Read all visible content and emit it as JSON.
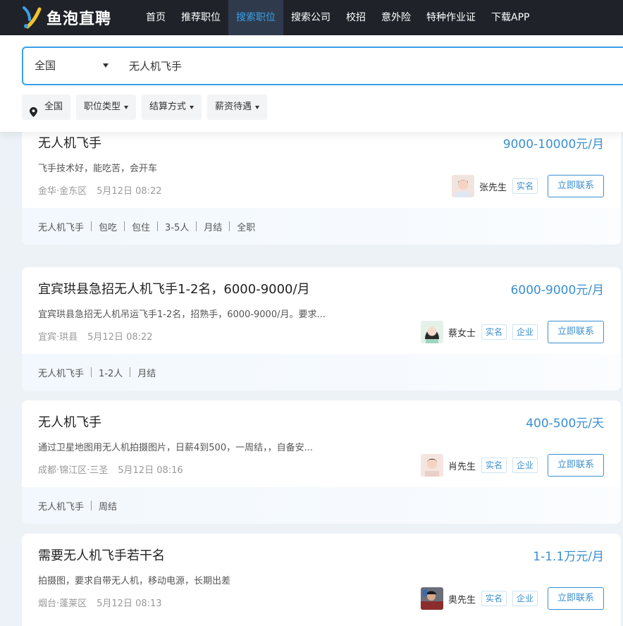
{
  "brand": {
    "name": "鱼泡直聘"
  },
  "nav": {
    "items": [
      {
        "label": "首页",
        "active": false
      },
      {
        "label": "推荐职位",
        "active": false
      },
      {
        "label": "搜索职位",
        "active": true
      },
      {
        "label": "搜索公司",
        "active": false
      },
      {
        "label": "校招",
        "active": false
      },
      {
        "label": "意外险",
        "active": false
      },
      {
        "label": "特种作业证",
        "active": false
      },
      {
        "label": "下载APP",
        "active": false
      }
    ]
  },
  "search": {
    "region": "全国",
    "query": "无人机飞手"
  },
  "filters": {
    "location": "全国",
    "job_type": "职位类型",
    "settlement": "结算方式",
    "salary": "薪资待遇"
  },
  "colors": {
    "accent": "#3a8fd0",
    "nav_bg": "#1f2329"
  },
  "jobs": [
    {
      "title": "无人机飞手",
      "salary": "9000-10000元/月",
      "desc": "飞手技术好，能吃苦，会开车",
      "location": "金华·金东区",
      "time": "5月12日 08:22",
      "contact": "张先生",
      "badges": [
        "实名"
      ],
      "avatar": "male-avatar-1",
      "tags": [
        "无人机飞手",
        "包吃",
        "包住",
        "3-5人",
        "月结",
        "全职"
      ]
    },
    {
      "title": "宜宾珙县急招无人机飞手1-2名，6000-9000/月",
      "salary": "6000-9000元/月",
      "desc": "宜宾珙县急招无人机吊运飞手1-2名，招熟手，6000-9000/月。要求...",
      "location": "宜宾·珙县",
      "time": "5月12日 08:22",
      "contact": "蔡女士",
      "badges": [
        "实名",
        "企业"
      ],
      "avatar": "female-avatar",
      "tags": [
        "无人机飞手",
        "1-2人",
        "月结"
      ]
    },
    {
      "title": "无人机飞手",
      "salary": "400-500元/天",
      "desc": "通过卫星地图用无人机拍摄图片，日薪4到500，一周结，，自备安...",
      "location": "成都·锦江区·三圣",
      "time": "5月12日 08:16",
      "contact": "肖先生",
      "badges": [
        "实名",
        "企业"
      ],
      "avatar": "male-avatar-2",
      "tags": [
        "无人机飞手",
        "周结"
      ]
    },
    {
      "title": "需要无人机飞手若干名",
      "salary": "1-1.1万元/月",
      "desc": "拍摄图，要求自带无人机，移动电源，长期出差",
      "location": "烟台·蓬莱区",
      "time": "5月12日 08:13",
      "contact": "奥先生",
      "badges": [
        "实名",
        "企业"
      ],
      "avatar": "photo-avatar",
      "tags": []
    }
  ],
  "contact_label": "立即联系"
}
